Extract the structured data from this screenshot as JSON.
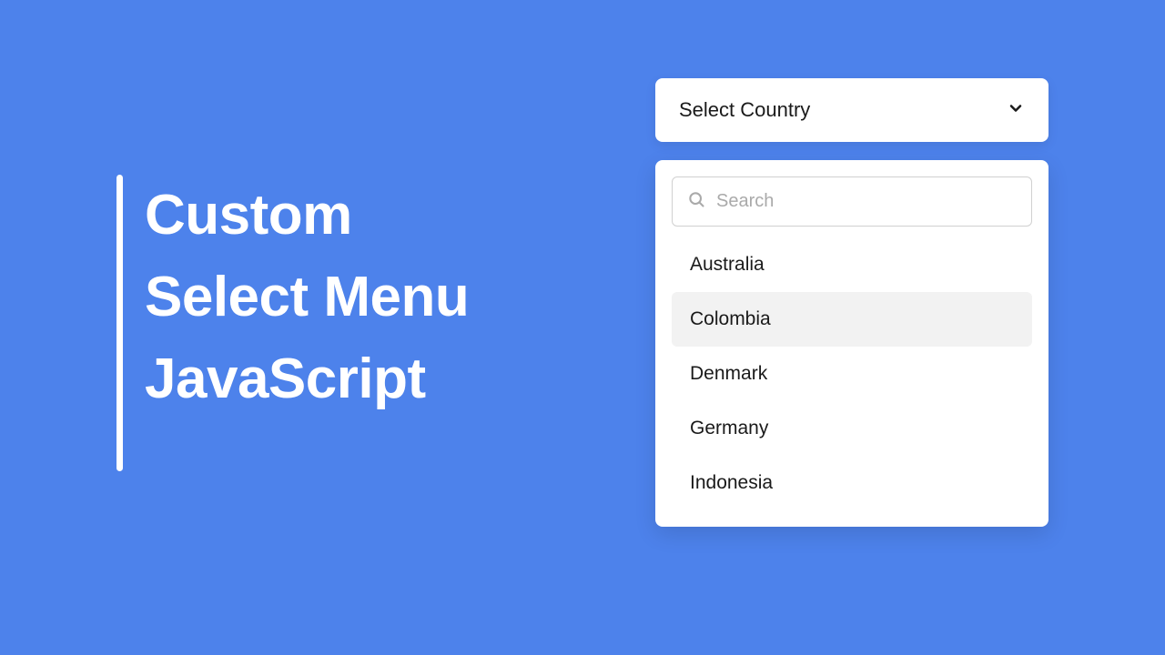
{
  "title": {
    "line1": "Custom",
    "line2": "Select Menu",
    "line3": "JavaScript"
  },
  "select": {
    "placeholder": "Select Country",
    "search_placeholder": "Search",
    "options": [
      {
        "label": "Australia",
        "hovered": false
      },
      {
        "label": "Colombia",
        "hovered": true
      },
      {
        "label": "Denmark",
        "hovered": false
      },
      {
        "label": "Germany",
        "hovered": false
      },
      {
        "label": "Indonesia",
        "hovered": false
      }
    ]
  }
}
